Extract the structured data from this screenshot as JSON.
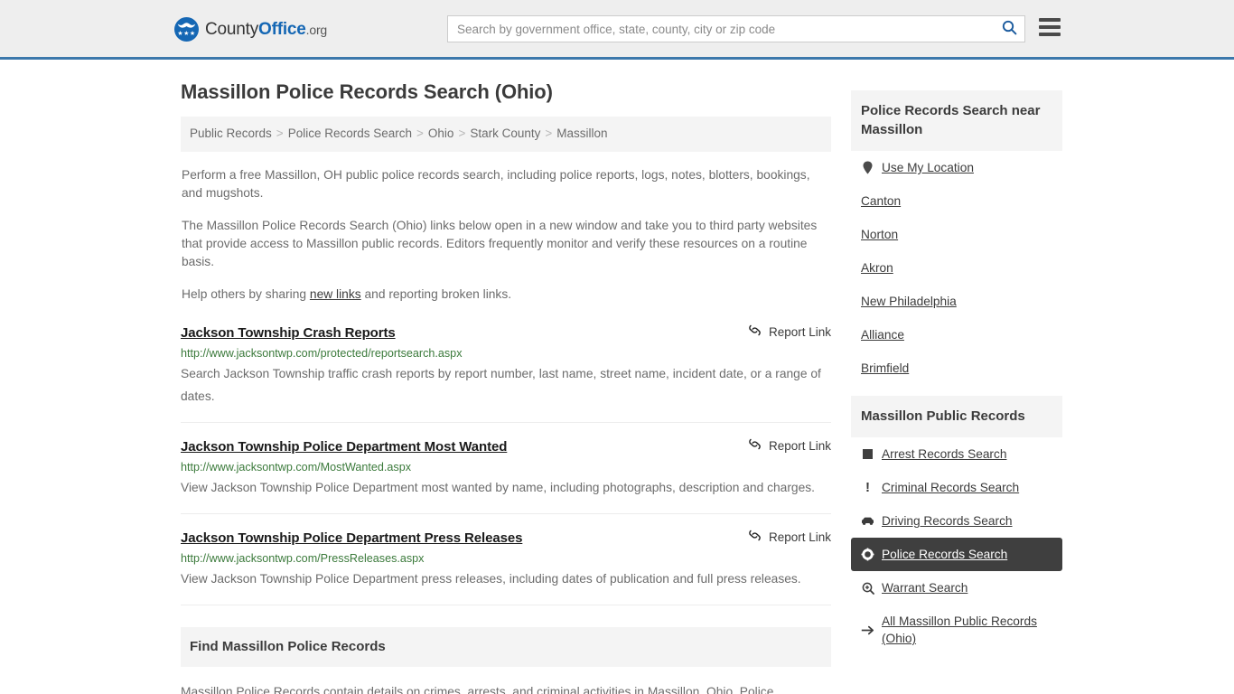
{
  "header": {
    "brand": {
      "part1": "County",
      "part2": "Office",
      "part3": ".org",
      "logo_icon": "eagle-seal-icon",
      "stars": "★★★"
    },
    "search": {
      "placeholder": "Search by government office, state, county, city or zip code",
      "value": "",
      "icon": "search-icon"
    },
    "menu_icon": "hamburger-menu-icon",
    "accent_color": "#3c78ab"
  },
  "page_title": "Massillon Police Records Search (Ohio)",
  "breadcrumb": {
    "items": [
      {
        "label": "Public Records",
        "current": false
      },
      {
        "label": "Police Records Search",
        "current": false
      },
      {
        "label": "Ohio",
        "current": false
      },
      {
        "label": "Stark County",
        "current": false
      },
      {
        "label": "Massillon",
        "current": true
      }
    ],
    "separator": ">"
  },
  "intro": {
    "p1": "Perform a free Massillon, OH public police records search, including police reports, logs, notes, blotters, bookings, and mugshots.",
    "p2": "The Massillon Police Records Search (Ohio) links below open in a new window and take you to third party websites that provide access to Massillon public records. Editors frequently monitor and verify these resources on a routine basis.",
    "p3_before": "Help others by sharing ",
    "p3_link": "new links",
    "p3_after": " and reporting broken links."
  },
  "report_link_label": "Report Link",
  "report_link_icon": "broken-link-icon",
  "results": [
    {
      "title": "Jackson Township Crash Reports",
      "url": "http://www.jacksontwp.com/protected/reportsearch.aspx",
      "description": "Search Jackson Township traffic crash reports by report number, last name, street name, incident date, or a range of dates."
    },
    {
      "title": "Jackson Township Police Department Most Wanted",
      "url": "http://www.jacksontwp.com/MostWanted.aspx",
      "description": "View Jackson Township Police Department most wanted by name, including photographs, description and charges."
    },
    {
      "title": "Jackson Township Police Department Press Releases",
      "url": "http://www.jacksontwp.com/PressReleases.aspx",
      "description": "View Jackson Township Police Department press releases, including dates of publication and full press releases."
    }
  ],
  "find_section": {
    "heading": "Find Massillon Police Records",
    "body": "Massillon Police Records contain details on crimes, arrests, and criminal activities in Massillon, Ohio. Police"
  },
  "sidebar": {
    "near_panel": {
      "heading": "Police Records Search near Massillon",
      "items": [
        {
          "label": "Use My Location",
          "icon": "map-pin-icon",
          "active": false
        },
        {
          "label": "Canton",
          "icon": "",
          "active": false
        },
        {
          "label": "Norton",
          "icon": "",
          "active": false
        },
        {
          "label": "Akron",
          "icon": "",
          "active": false
        },
        {
          "label": "New Philadelphia",
          "icon": "",
          "active": false
        },
        {
          "label": "Alliance",
          "icon": "",
          "active": false
        },
        {
          "label": "Brimfield",
          "icon": "",
          "active": false
        }
      ]
    },
    "public_records_panel": {
      "heading": "Massillon Public Records",
      "items": [
        {
          "label": "Arrest Records Search",
          "icon": "fingerprint-icon",
          "active": false
        },
        {
          "label": "Criminal Records Search",
          "icon": "exclamation-icon",
          "active": false
        },
        {
          "label": "Driving Records Search",
          "icon": "car-icon",
          "active": false
        },
        {
          "label": "Police Records Search",
          "icon": "police-badge-icon",
          "active": true
        },
        {
          "label": "Warrant Search",
          "icon": "magnifier-plus-icon",
          "active": false
        },
        {
          "label": "All Massillon Public Records (Ohio)",
          "icon": "arrow-right-icon",
          "active": false
        }
      ]
    },
    "active_bg_color": "#3f3f3f"
  }
}
